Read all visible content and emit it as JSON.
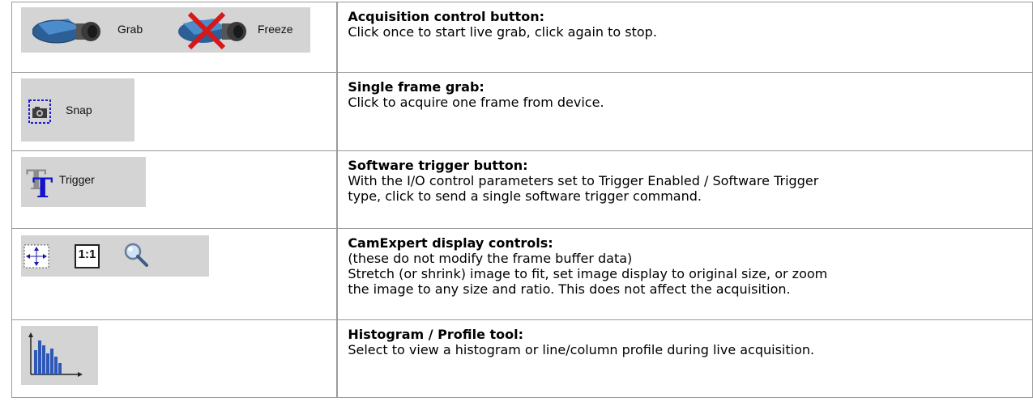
{
  "rows": [
    {
      "title": "Acquisition control button:",
      "desc": [
        "Click once to start live grab, click again to stop."
      ],
      "buttons": [
        {
          "icon": "camera-icon",
          "label": "Grab"
        },
        {
          "icon": "camera-crossed-icon",
          "label": "Freeze"
        }
      ]
    },
    {
      "title": "Single frame grab:",
      "desc": [
        "Click to acquire one frame from device."
      ],
      "buttons": [
        {
          "icon": "snap-camera-icon",
          "label": "Snap"
        }
      ]
    },
    {
      "title": "Software trigger button:",
      "desc": [
        "With the I/O control parameters set to Trigger Enabled / Software Trigger",
        "type, click to send a single software trigger command."
      ],
      "buttons": [
        {
          "icon": "trigger-t-icon",
          "label": "Trigger"
        }
      ]
    },
    {
      "title": "CamExpert display controls:",
      "desc": [
        "(these do not modify the frame buffer data)",
        "Stretch (or shrink) image to fit, set image display to original size, or zoom",
        "the image to any size and ratio. This does not affect the acquisition."
      ],
      "buttons": [
        {
          "icon": "fit-to-window-icon",
          "label": ""
        },
        {
          "icon": "original-size-icon",
          "label": "1:1"
        },
        {
          "icon": "magnifier-icon",
          "label": ""
        }
      ]
    },
    {
      "title": "Histogram / Profile tool:",
      "desc": [
        "Select to view a histogram or line/column profile during live acquisition."
      ],
      "buttons": [
        {
          "icon": "histogram-icon",
          "label": ""
        }
      ]
    }
  ]
}
